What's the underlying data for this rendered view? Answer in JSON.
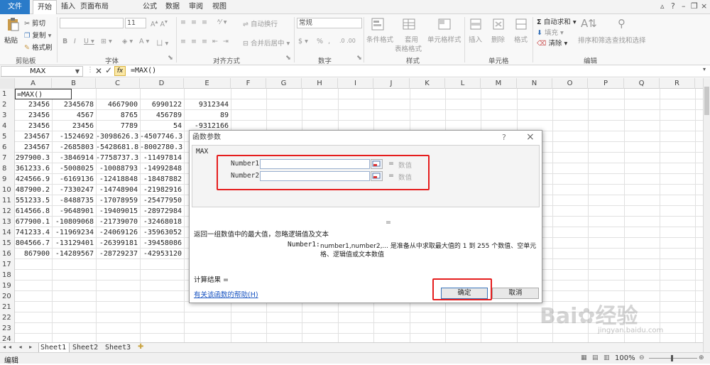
{
  "ribbon_tabs": [
    "文件",
    "开始",
    "插入",
    "页面布局",
    "公式",
    "数据",
    "审阅",
    "视图"
  ],
  "clipboard": {
    "paste": "粘贴",
    "cut": "剪切",
    "copy": "复制",
    "format_painter": "格式刷",
    "label": "剪贴板"
  },
  "font": {
    "size": "11",
    "label": "字体"
  },
  "alignment": {
    "wrap_text": "自动换行",
    "merge_center": "合并后居中",
    "label": "对齐方式"
  },
  "number": {
    "format": "常规",
    "percent": "%",
    "comma": ",",
    "label": "数字"
  },
  "styles": {
    "conditional": "条件格式",
    "table_line1": "套用",
    "table_line2": "表格格式",
    "cell_styles": "单元格样式",
    "label": "样式"
  },
  "cells": {
    "insert": "插入",
    "delete": "删除",
    "format": "格式",
    "label": "单元格"
  },
  "editing": {
    "autosum": "自动求和",
    "fill": "填充",
    "clear": "清除",
    "sort_filter": "排序和筛选",
    "find_select": "查找和选择",
    "label": "编辑"
  },
  "name_box": "MAX",
  "fx": "fx",
  "formula": "=MAX()",
  "columns": [
    "A",
    "B",
    "C",
    "D",
    "E",
    "F",
    "G",
    "H",
    "I",
    "J",
    "K",
    "L",
    "M",
    "N",
    "O",
    "P",
    "Q",
    "R"
  ],
  "rows": [
    "1",
    "2",
    "3",
    "4",
    "5",
    "6",
    "7",
    "8",
    "9",
    "10",
    "11",
    "12",
    "13",
    "14",
    "15",
    "16",
    "17",
    "18",
    "19",
    "20",
    "21",
    "22",
    "23",
    "24"
  ],
  "cell_a1": "=MAX()",
  "table": [
    [
      "23456",
      "2345678",
      "4667900",
      "6990122",
      "9312344"
    ],
    [
      "23456",
      "4567",
      "8765",
      "456789",
      "89"
    ],
    [
      "23456",
      "23456",
      "7789",
      "54",
      "-9312166"
    ],
    [
      "234567",
      "-1524692",
      "-3098626.3",
      "-4507746.3",
      "-"
    ],
    [
      "234567",
      "-2685803",
      "-5428681.8",
      "-8002780.3",
      "-"
    ],
    [
      "297900.3",
      "-3846914",
      "-7758737.3",
      "-11497814",
      ""
    ],
    [
      "361233.6",
      "-5008025",
      "-10088793",
      "-14992848",
      ""
    ],
    [
      "424566.9",
      "-6169136",
      "-12418848",
      "-18487882",
      ""
    ],
    [
      "487900.2",
      "-7330247",
      "-14748904",
      "-21982916",
      ""
    ],
    [
      "551233.5",
      "-8488735",
      "-17078959",
      "-25477950",
      ""
    ],
    [
      "614566.8",
      "-9648901",
      "-19409015",
      "-28972984",
      ""
    ],
    [
      "677900.1",
      "-10809068",
      "-21739070",
      "-32468018",
      ""
    ],
    [
      "741233.4",
      "-11969234",
      "-24069126",
      "-35963052",
      ""
    ],
    [
      "804566.7",
      "-13129401",
      "-26399181",
      "-39458086",
      ""
    ],
    [
      "867900",
      "-14289567",
      "-28729237",
      "-42953120",
      ""
    ]
  ],
  "sheets": [
    "Sheet1",
    "Sheet2",
    "Sheet3"
  ],
  "status": {
    "mode": "编辑",
    "zoom": "100%"
  },
  "dialog": {
    "title": "函数参数",
    "help_icon": "?",
    "close_icon": "×",
    "function_name": "MAX",
    "arg1_label": "Number1",
    "arg2_label": "Number2",
    "eq": "=",
    "arg_placeholder": "数值",
    "result_eq": "=",
    "description": "返回一组数值中的最大值，忽略逻辑值及文本",
    "arg_help_name": "Number1:",
    "arg_help_line1": "number1,number2,... 是准备从中求取最大值的 1 到 255 个数值、空单元",
    "arg_help_line2": "格、逻辑值或文本数值",
    "calc_result": "计算结果 =",
    "help_link": "有关该函数的帮助(H)",
    "ok": "确定",
    "cancel": "取消"
  },
  "watermark": {
    "brand": "Bai",
    "brand2": "经验",
    "url": "jingyan.baidu.com"
  },
  "colors": {
    "file_tab": "#2a7bc9",
    "highlight": "#e51d1d"
  }
}
